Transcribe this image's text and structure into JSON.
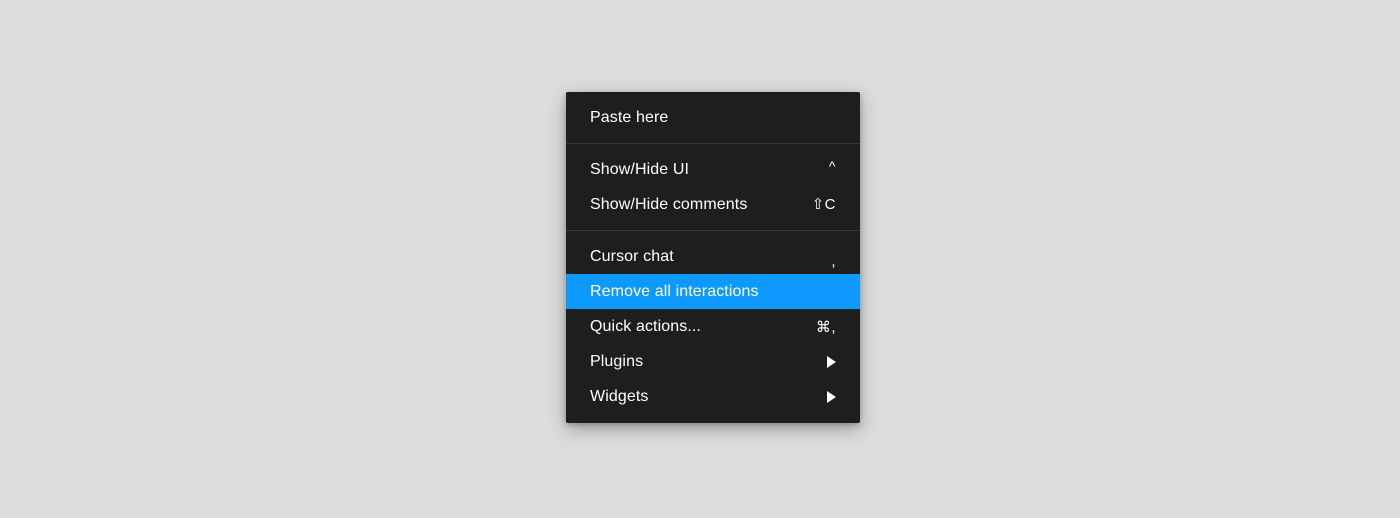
{
  "canvas": {
    "background_color": "#dcdcdc"
  },
  "context_menu": {
    "background_color": "#1e1e1e",
    "highlight_color": "#0d99ff",
    "text_color": "#ffffff",
    "separator_color": "#383838",
    "sections": [
      {
        "items": [
          {
            "label": "Paste here",
            "shortcut": "",
            "has_submenu": false,
            "highlighted": false
          }
        ]
      },
      {
        "items": [
          {
            "label": "Show/Hide UI",
            "shortcut": "^",
            "has_submenu": false,
            "highlighted": false
          },
          {
            "label": "Show/Hide comments",
            "shortcut": "⇧C",
            "has_submenu": false,
            "highlighted": false
          }
        ]
      },
      {
        "items": [
          {
            "label": "Cursor chat",
            "shortcut": ",",
            "has_submenu": false,
            "highlighted": false
          },
          {
            "label": "Remove all interactions",
            "shortcut": "",
            "has_submenu": false,
            "highlighted": true
          },
          {
            "label": "Quick actions...",
            "shortcut": "⌘,",
            "has_submenu": false,
            "highlighted": false
          },
          {
            "label": "Plugins",
            "shortcut": "",
            "has_submenu": true,
            "highlighted": false
          },
          {
            "label": "Widgets",
            "shortcut": "",
            "has_submenu": true,
            "highlighted": false
          }
        ]
      }
    ]
  }
}
